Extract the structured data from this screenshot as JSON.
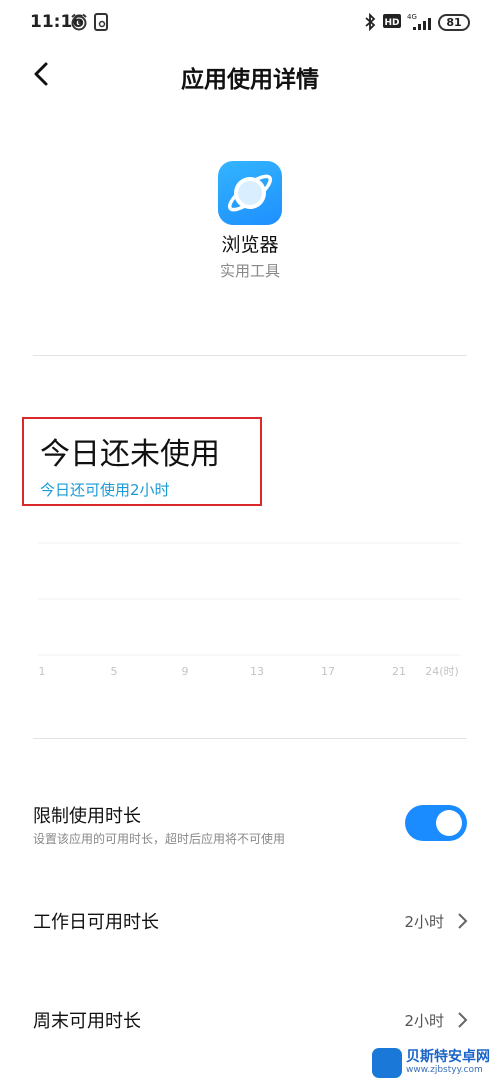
{
  "status_bar": {
    "time": "11:16",
    "network": "4G",
    "battery": "81"
  },
  "header": {
    "title": "应用使用详情"
  },
  "app": {
    "name": "浏览器",
    "category": "实用工具"
  },
  "usage": {
    "title": "今日还未使用",
    "subtitle": "今日还可使用2小时"
  },
  "chart_data": {
    "type": "bar",
    "x_ticks": [
      "1",
      "5",
      "9",
      "13",
      "17",
      "21",
      "24(时)"
    ],
    "values": [],
    "grid": true
  },
  "limit": {
    "label": "限制使用时长",
    "description": "设置该应用的可用时长，超时后应用将不可使用",
    "enabled": true
  },
  "rows": [
    {
      "label": "工作日可用时长",
      "value": "2小时"
    },
    {
      "label": "周末可用时长",
      "value": "2小时"
    }
  ],
  "watermark": {
    "name": "贝斯特安卓网",
    "url": "www.zjbstyy.com"
  },
  "colors": {
    "accent": "#1a8cff",
    "link": "#1a9bd7",
    "highlight_border": "#d9292a"
  }
}
